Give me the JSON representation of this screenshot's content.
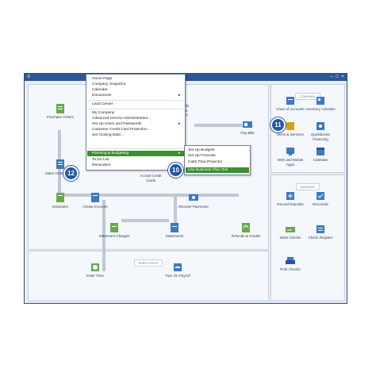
{
  "menu": {
    "items": [
      {
        "label": "Home Page"
      },
      {
        "label": "Company Snapshot"
      },
      {
        "label": "Calendar"
      },
      {
        "label": "Documents",
        "arrow": "▸"
      },
      {
        "label": "Lead Center"
      },
      {
        "label": "My Company"
      },
      {
        "label": "Advanced Service Administration..."
      },
      {
        "label": "Set Up Users and Passwords",
        "arrow": "▸"
      },
      {
        "label": "Customer Credit Card Protection..."
      },
      {
        "label": "Set Closing Date..."
      },
      {
        "label": "Planning & Budgeting",
        "arrow": "▸"
      },
      {
        "label": "To Do List"
      },
      {
        "label": "Reminders"
      }
    ]
  },
  "submenu": {
    "items": [
      {
        "label": "Set Up Budgets"
      },
      {
        "label": "Set Up Forecast"
      },
      {
        "label": "Cash Flow Projector"
      },
      {
        "label": "Use Business Plan Tool"
      }
    ]
  },
  "company_panel": {
    "heading": "COMPANY",
    "items": [
      {
        "label": "Chart of Accounts"
      },
      {
        "label": "Inventory Activities"
      },
      {
        "label": "Items & Services"
      },
      {
        "label": "QuickBooks Financing"
      },
      {
        "label": "Web and Mobile Apps"
      },
      {
        "label": "Calendar"
      }
    ]
  },
  "banking_panel": {
    "heading": "BANKING",
    "items": [
      {
        "label": "Record Deposits"
      },
      {
        "label": "Reconcile"
      },
      {
        "label": "Write Checks"
      },
      {
        "label": "Check Register"
      },
      {
        "label": "Print Checks"
      }
    ]
  },
  "employees_panel": {
    "heading": "EMPLOYEES",
    "items": [
      {
        "label": "Enter Time"
      },
      {
        "label": "Turn On Payroll"
      }
    ]
  },
  "workflow": {
    "purchase_orders": "Purchase Orders",
    "sales_orders": "Sales Orders",
    "estimates": "Estimates",
    "create_invoices": "Create Invoices",
    "accept_credit_cards": "Accept Credit Cards",
    "receive_payments": "Receive Payments",
    "statement_charges": "Statement Charges",
    "statements": "Statements",
    "refunds_credits": "Refunds & Credits",
    "pay_bills": "Pay Bills",
    "enter_bills_partial": "ills\nst\nry"
  },
  "callouts": {
    "c10": "10",
    "c11": "11",
    "c12": "12"
  },
  "colors": {
    "titlebar": "#2b5797",
    "highlight": "#3c8f2f",
    "callout": "#2456a6"
  }
}
